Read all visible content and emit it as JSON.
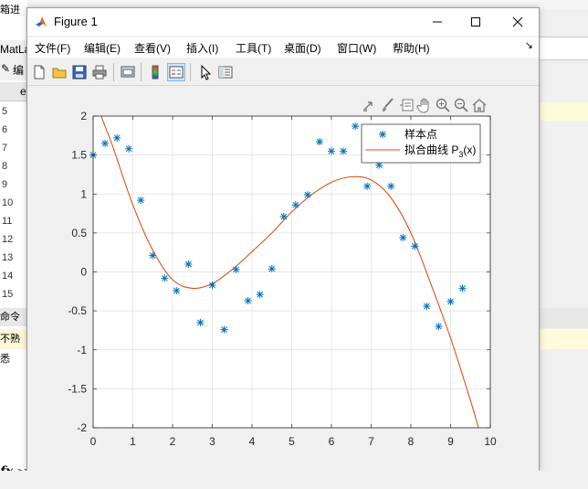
{
  "window": {
    "title": "Figure 1"
  },
  "menu": [
    "文件(F)",
    "编辑(E)",
    "查看(V)",
    "插入(I)",
    "工具(T)",
    "桌面(D)",
    "窗口(W)",
    "帮助(H)"
  ],
  "background": {
    "line_numbers": [
      "5",
      "6",
      "7",
      "8",
      "9",
      "10",
      "11",
      "12",
      "13",
      "14",
      "15"
    ],
    "matlab_label": "MatLa",
    "edit_label": "编",
    "tab_label": "e",
    "cmd_label": "命令行",
    "warn_label": "不熟悉",
    "top_label": "箱进",
    "fx_label": "fx",
    "prompt": ">>"
  },
  "legend": {
    "samples": "样本点",
    "fit": "拟合曲线 P",
    "fit_sub": "3",
    "fit_suffix": "(x)"
  },
  "chart_data": {
    "type": "scatter",
    "xlim": [
      0,
      10
    ],
    "ylim": [
      -2,
      2
    ],
    "xticks": [
      0,
      1,
      2,
      3,
      4,
      5,
      6,
      7,
      8,
      9,
      10
    ],
    "yticks": [
      -2,
      -1.5,
      -1,
      -0.5,
      0,
      0.5,
      1,
      1.5,
      2
    ],
    "grid": true,
    "legend_position": "top-right",
    "series": [
      {
        "name": "样本点",
        "marker": "*",
        "color": "#0072BD",
        "x": [
          0.0,
          0.3,
          0.6,
          0.9,
          1.2,
          1.5,
          1.8,
          2.1,
          2.4,
          2.7,
          3.0,
          3.3,
          3.6,
          3.9,
          4.2,
          4.5,
          4.8,
          5.1,
          5.4,
          5.7,
          6.0,
          6.3,
          6.6,
          6.9,
          7.2,
          7.5,
          7.8,
          8.1,
          8.4,
          8.7,
          9.0,
          9.3
        ],
        "y": [
          1.5,
          1.65,
          1.72,
          1.58,
          0.92,
          0.21,
          -0.08,
          -0.24,
          0.1,
          -0.65,
          -0.17,
          -0.74,
          0.03,
          -0.37,
          -0.29,
          0.04,
          0.71,
          0.86,
          0.99,
          1.67,
          1.55,
          1.55,
          1.87,
          1.1,
          1.37,
          1.1,
          0.44,
          0.33,
          -0.44,
          -0.7,
          -0.38,
          -0.21
        ]
      },
      {
        "name": "拟合曲线 P3(x)",
        "type": "line",
        "color": "#D95319",
        "x": [
          0.2,
          0.5,
          1.0,
          1.5,
          2.0,
          2.5,
          3.0,
          3.5,
          4.0,
          4.5,
          5.0,
          5.5,
          6.0,
          6.5,
          7.0,
          7.5,
          8.0,
          8.5,
          9.0,
          9.5,
          9.7
        ],
        "y": [
          2.0,
          1.6,
          0.86,
          0.28,
          -0.1,
          -0.21,
          -0.15,
          0.03,
          0.26,
          0.5,
          0.77,
          0.99,
          1.15,
          1.22,
          1.18,
          0.95,
          0.5,
          -0.15,
          -0.85,
          -1.65,
          -2.0
        ]
      }
    ]
  }
}
